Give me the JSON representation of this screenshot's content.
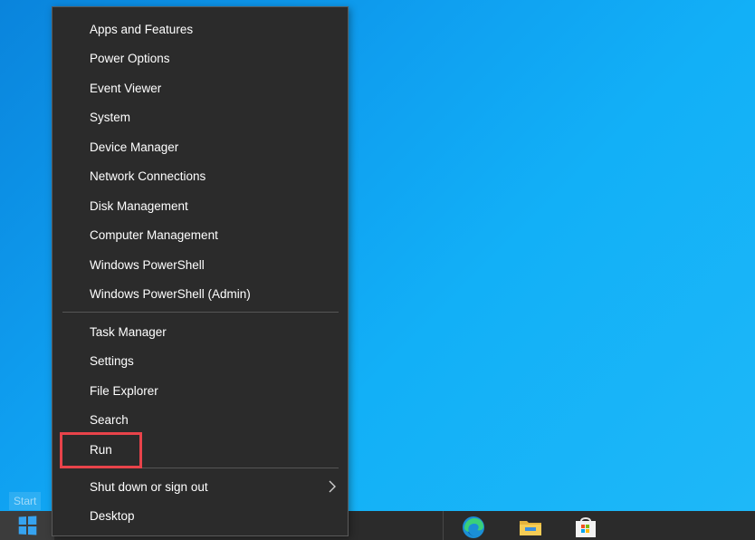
{
  "desktop": {
    "start_tooltip": "Start"
  },
  "context_menu": {
    "group1": [
      {
        "label": "Apps and Features"
      },
      {
        "label": "Power Options"
      },
      {
        "label": "Event Viewer"
      },
      {
        "label": "System"
      },
      {
        "label": "Device Manager"
      },
      {
        "label": "Network Connections"
      },
      {
        "label": "Disk Management"
      },
      {
        "label": "Computer Management"
      },
      {
        "label": "Windows PowerShell"
      },
      {
        "label": "Windows PowerShell (Admin)"
      }
    ],
    "group2": [
      {
        "label": "Task Manager"
      },
      {
        "label": "Settings"
      },
      {
        "label": "File Explorer"
      },
      {
        "label": "Search"
      },
      {
        "label": "Run",
        "highlighted": true
      }
    ],
    "group3": [
      {
        "label": "Shut down or sign out",
        "has_submenu": true
      },
      {
        "label": "Desktop"
      }
    ],
    "highlight_color": "#e8434a"
  },
  "taskbar": {
    "icons": [
      "windows-logo-icon",
      "edge-icon",
      "file-explorer-icon",
      "store-icon"
    ],
    "accent": "#36a3f0"
  }
}
